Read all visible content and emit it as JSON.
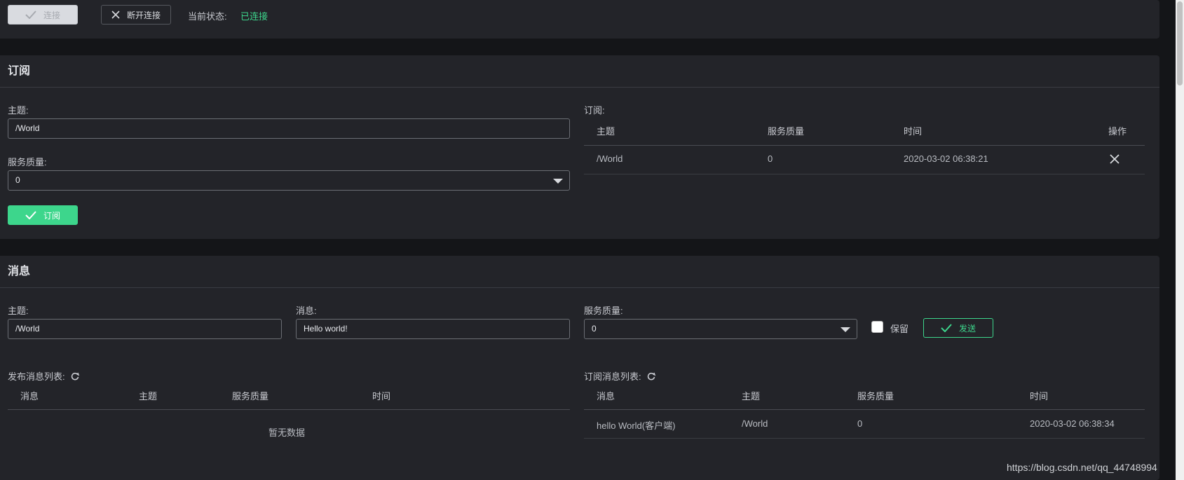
{
  "connection": {
    "connect_label": "连接",
    "disconnect_label": "断开连接",
    "status_label": "当前状态:",
    "status_value": "已连接",
    "status_color": "#3dd68c"
  },
  "subscribe": {
    "title": "订阅",
    "topic_label": "主题:",
    "topic_value": "/World",
    "qos_label": "服务质量:",
    "qos_value": "0",
    "submit_label": "订阅",
    "list_label": "订阅:",
    "columns": [
      "主题",
      "服务质量",
      "时间",
      "操作"
    ],
    "rows": [
      {
        "topic": "/World",
        "qos": "0",
        "time": "2020-03-02 06:38:21",
        "action_icon": "close-icon"
      }
    ]
  },
  "message": {
    "title": "消息",
    "topic_label": "主题:",
    "topic_value": "/World",
    "message_label": "消息:",
    "message_value": "Hello world!",
    "qos_label": "服务质量:",
    "qos_value": "0",
    "retain_label": "保留",
    "send_label": "发送",
    "published": {
      "label": "发布消息列表:",
      "columns": [
        "消息",
        "主题",
        "服务质量",
        "时间"
      ],
      "empty_text": "暂无数据"
    },
    "received": {
      "label": "订阅消息列表:",
      "columns": [
        "消息",
        "主题",
        "服务质量",
        "时间"
      ],
      "rows": [
        {
          "message": "hello World(客户端)",
          "topic": "/World",
          "qos": "0",
          "time": "2020-03-02 06:38:34"
        }
      ]
    }
  },
  "watermark": "https://blog.csdn.net/qq_44748994",
  "colors": {
    "accent_green": "#3dd68c",
    "card_bg": "#232429",
    "page_bg": "#141518"
  }
}
